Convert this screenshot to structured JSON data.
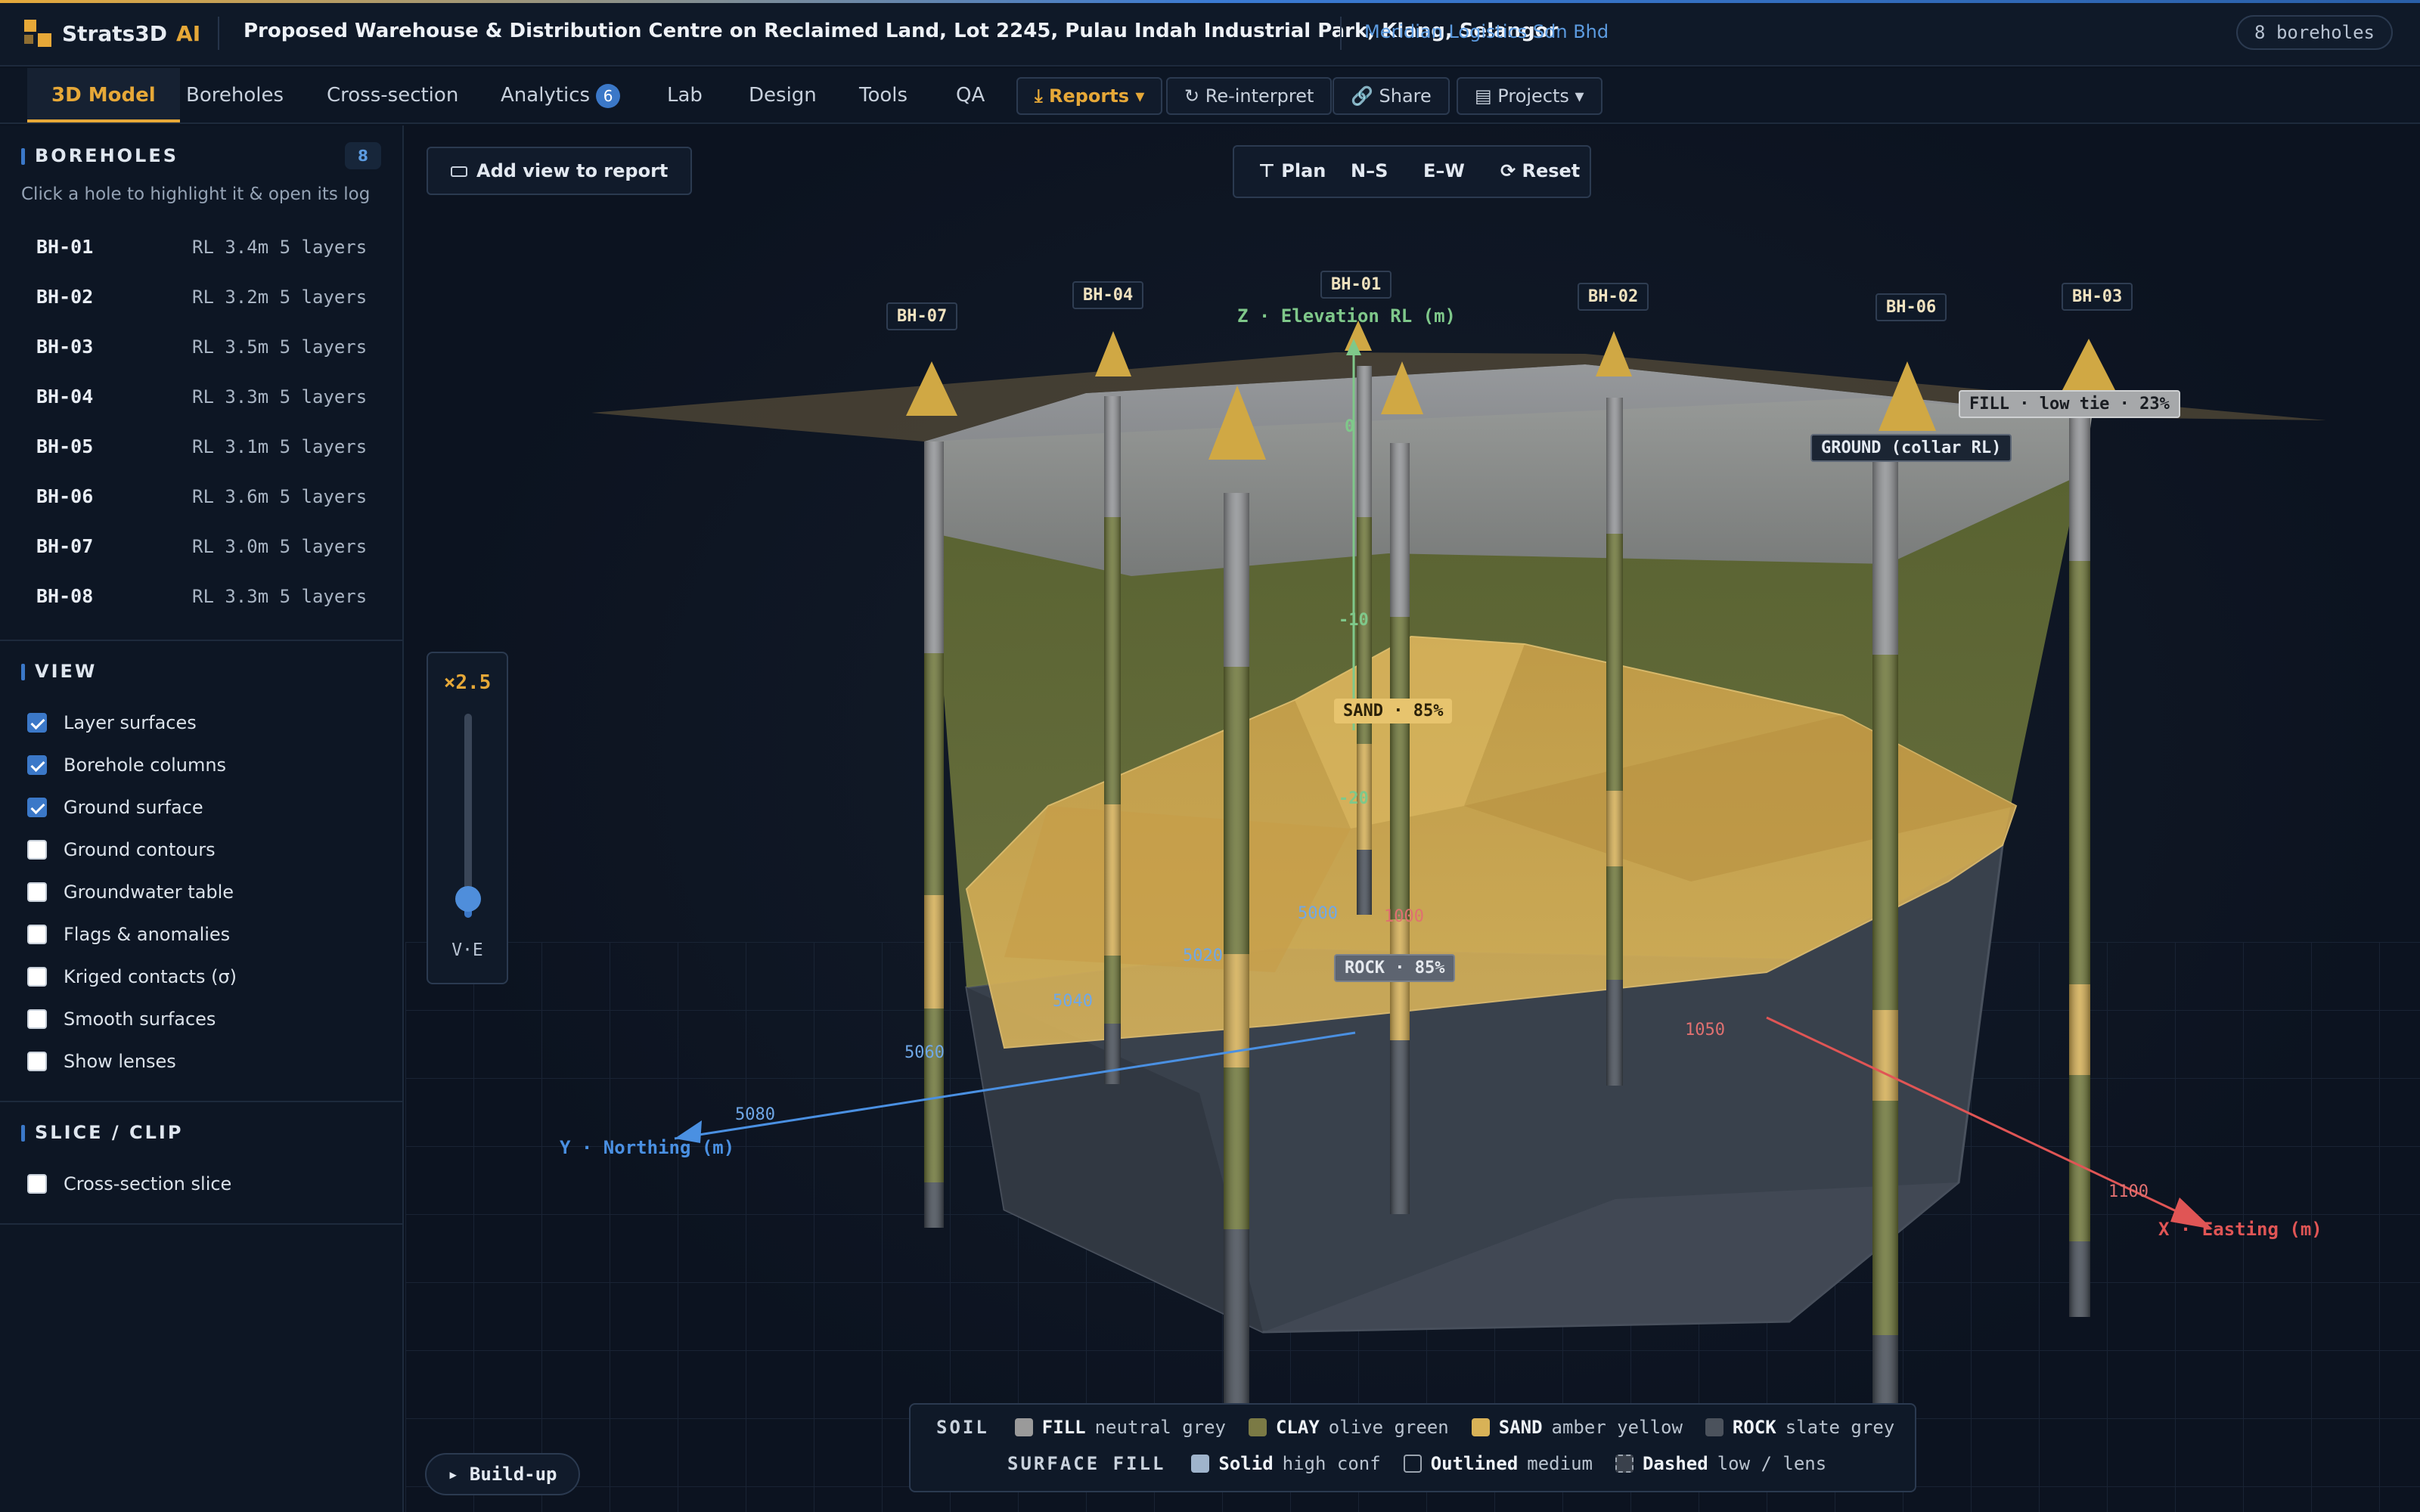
{
  "app": {
    "brand": "Strats3D",
    "brand_ai": "AI",
    "project_title": "Proposed Warehouse & Distribution Centre on Reclaimed Land, Lot 2245, Pulau Indah Industrial Park, Klang, Selangor",
    "client": "Meridian Logistics Sdn Bhd",
    "borehole_badge": "8 boreholes"
  },
  "tabs": [
    {
      "label": "3D Model",
      "active": true
    },
    {
      "label": "Boreholes"
    },
    {
      "label": "Cross-section"
    },
    {
      "label": "Analytics",
      "count": "6"
    },
    {
      "label": "Lab"
    },
    {
      "label": "Design"
    },
    {
      "label": "Tools"
    },
    {
      "label": "QA"
    }
  ],
  "toolbar": {
    "reports": "⤓ Reports ▾",
    "reinterpret": "↻ Re-interpret",
    "share": "🔗 Share",
    "projects": "▤ Projects ▾"
  },
  "sidebar": {
    "boreholes_title": "BOREHOLES",
    "boreholes_count": "8",
    "hint": "Click a hole to highlight it & open its log",
    "boreholes": [
      {
        "id": "BH-01",
        "meta": "RL 3.4m 5 layers"
      },
      {
        "id": "BH-02",
        "meta": "RL 3.2m 5 layers"
      },
      {
        "id": "BH-03",
        "meta": "RL 3.5m 5 layers"
      },
      {
        "id": "BH-04",
        "meta": "RL 3.3m 5 layers"
      },
      {
        "id": "BH-05",
        "meta": "RL 3.1m 5 layers"
      },
      {
        "id": "BH-06",
        "meta": "RL 3.6m 5 layers"
      },
      {
        "id": "BH-07",
        "meta": "RL 3.0m 5 layers"
      },
      {
        "id": "BH-08",
        "meta": "RL 3.3m 5 layers"
      }
    ],
    "view_title": "VIEW",
    "view_options": [
      {
        "label": "Layer surfaces",
        "checked": true
      },
      {
        "label": "Borehole columns",
        "checked": true
      },
      {
        "label": "Ground surface",
        "checked": true
      },
      {
        "label": "Ground contours",
        "checked": false
      },
      {
        "label": "Groundwater table",
        "checked": false
      },
      {
        "label": "Flags & anomalies",
        "checked": false
      },
      {
        "label": "Kriged contacts (σ)",
        "checked": false
      },
      {
        "label": "Smooth surfaces",
        "checked": false
      },
      {
        "label": "Show lenses",
        "checked": false
      }
    ],
    "slice_title": "SLICE / CLIP",
    "slice_options": [
      {
        "label": "Cross-section slice",
        "checked": false
      }
    ]
  },
  "viewport": {
    "add_view": "Add view to report",
    "view_buttons": [
      "⊤ Plan",
      "N–S",
      "E–W",
      "⟳ Reset"
    ],
    "ve_value": "×2.5",
    "ve_label": "V·E",
    "ve_level": 0.1,
    "buildup": "▸ Build-up",
    "z_axis_label": "Z · Elevation RL (m)",
    "z_ticks": [
      "0",
      "-10",
      "-20"
    ],
    "y_axis_label": "Y · Northing (m)",
    "y_ticks": [
      "5000",
      "5020",
      "5040",
      "5060",
      "5080"
    ],
    "x_axis_label": "X · Easting (m)",
    "x_ticks": [
      "1000",
      "1050",
      "1100"
    ],
    "bh_labels": [
      "BH-07",
      "BH-04",
      "BH-01",
      "BH-02",
      "BH-06",
      "BH-03"
    ],
    "tag_fill": "FILL · low tie · 23%",
    "tag_ground": "GROUND (collar RL)",
    "tag_sand": "SAND · 85%",
    "tag_rock": "ROCK · 85%"
  },
  "legend": {
    "soil_title": "SOIL",
    "soil": [
      {
        "name": "FILL",
        "desc": "neutral grey",
        "color": "#9a9a9a"
      },
      {
        "name": "CLAY",
        "desc": "olive green",
        "color": "#7b7a45"
      },
      {
        "name": "SAND",
        "desc": "amber yellow",
        "color": "#d8b257"
      },
      {
        "name": "ROCK",
        "desc": "slate grey",
        "color": "#4b525c"
      }
    ],
    "fill_title": "SURFACE FILL",
    "fill": [
      {
        "name": "Solid",
        "desc": "high conf"
      },
      {
        "name": "Outlined",
        "desc": "medium"
      },
      {
        "name": "Dashed",
        "desc": "low / lens"
      }
    ]
  },
  "colors": {
    "accent": "#e6a838",
    "link": "#5c9be0",
    "fill": "#8d8f91",
    "clay": "#6c7338",
    "sand": "#d6ad50",
    "rock": "#3d4550",
    "x_axis": "#e05555",
    "y_axis": "#4a90e2",
    "z_axis": "#7fc88a"
  }
}
